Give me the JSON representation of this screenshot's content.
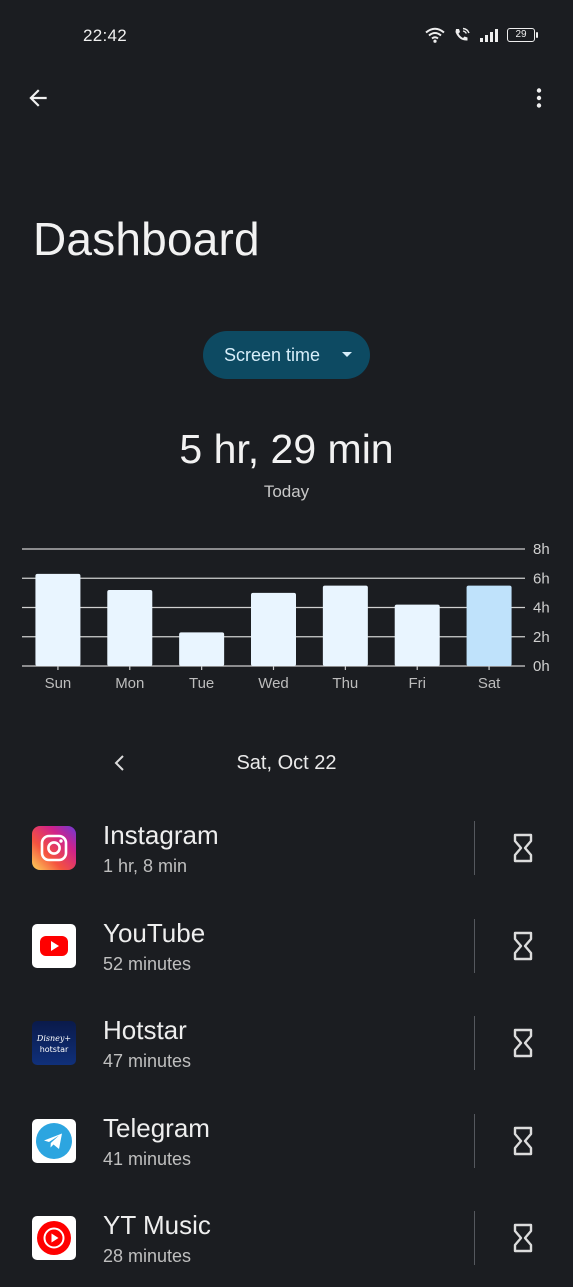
{
  "status_bar": {
    "time": "22:42",
    "battery": "29"
  },
  "page": {
    "title": "Dashboard"
  },
  "dropdown": {
    "label": "Screen time"
  },
  "summary": {
    "total": "5 hr, 29 min",
    "period": "Today"
  },
  "chart_data": {
    "type": "bar",
    "categories": [
      "Sun",
      "Mon",
      "Tue",
      "Wed",
      "Thu",
      "Fri",
      "Sat"
    ],
    "values": [
      6.3,
      5.2,
      2.3,
      5.0,
      5.5,
      4.2,
      5.5
    ],
    "y_ticks": [
      "0h",
      "2h",
      "4h",
      "6h",
      "8h"
    ],
    "ylim": [
      0,
      8
    ],
    "grid": true,
    "selected_index": 6,
    "bar_color": "#e9f5ff",
    "selected_bar_color": "#bfe2fb"
  },
  "date_nav": {
    "date": "Sat, Oct 22"
  },
  "apps": [
    {
      "name": "Instagram",
      "usage": "1 hr, 8 min",
      "icon": "instagram-icon"
    },
    {
      "name": "YouTube",
      "usage": "52 minutes",
      "icon": "youtube-icon"
    },
    {
      "name": "Hotstar",
      "usage": "47 minutes",
      "icon": "hotstar-icon",
      "icon_text_top": "Disney+",
      "icon_text_bottom": "hotstar"
    },
    {
      "name": "Telegram",
      "usage": "41 minutes",
      "icon": "telegram-icon"
    },
    {
      "name": "YT Music",
      "usage": "28 minutes",
      "icon": "yt-music-icon"
    }
  ]
}
